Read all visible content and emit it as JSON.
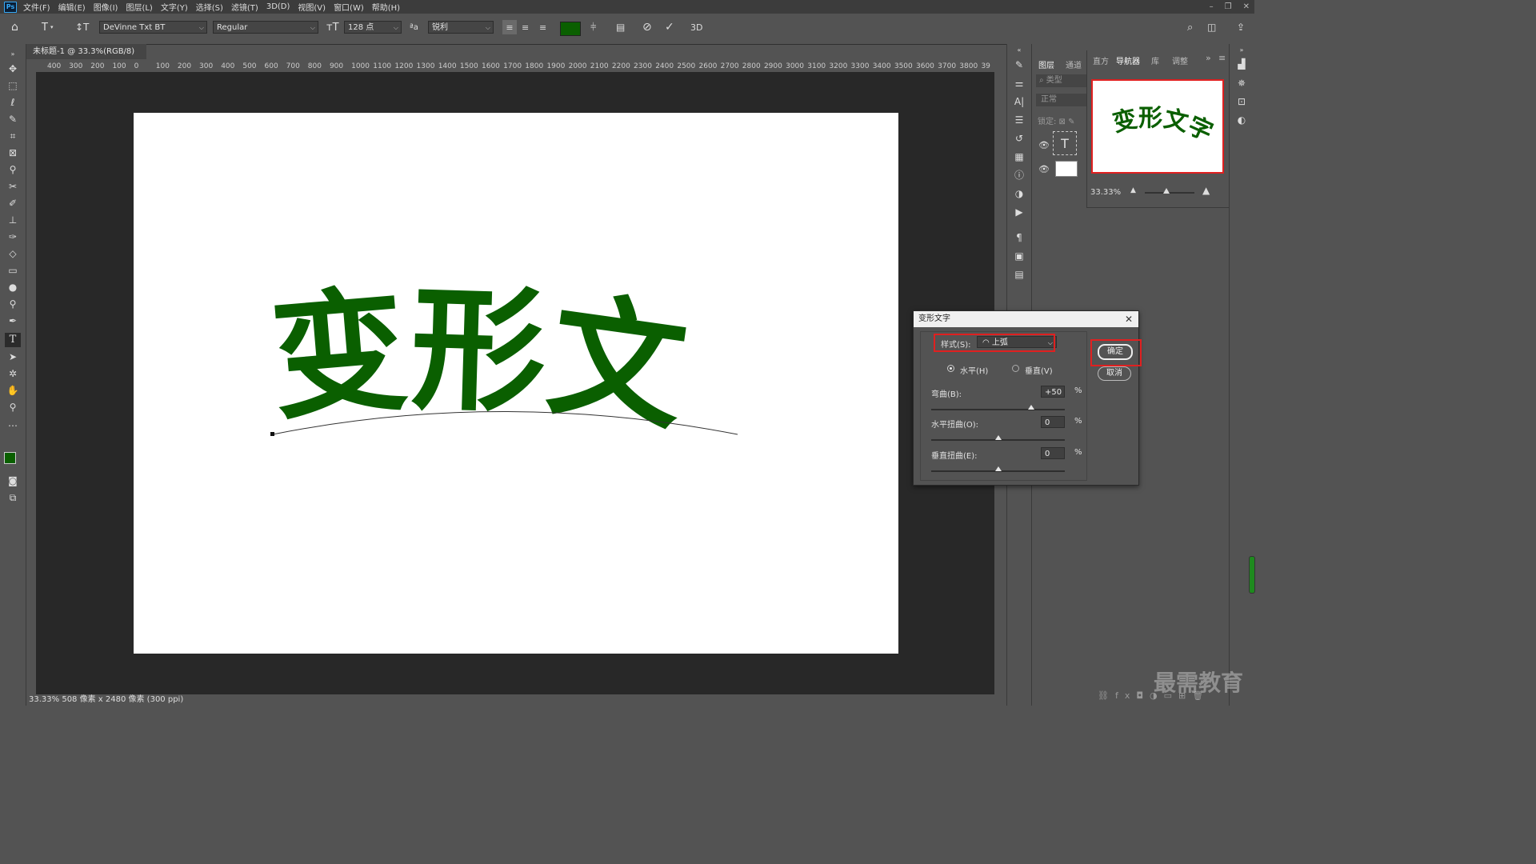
{
  "app": {
    "logo": "Ps"
  },
  "menu": [
    "文件(F)",
    "编辑(E)",
    "图像(I)",
    "图层(L)",
    "文字(Y)",
    "选择(S)",
    "滤镜(T)",
    "3D(D)",
    "视图(V)",
    "窗口(W)",
    "帮助(H)"
  ],
  "window_controls": [
    "–",
    "❐",
    "✕"
  ],
  "options": {
    "font_family": "DeVinne Txt BT",
    "font_style": "Regular",
    "font_size": "128 点",
    "aa_label": "ªa",
    "antialias": "锐利",
    "color": "#0a5f00",
    "threed": "3D"
  },
  "document": {
    "tab_title": "未标题-1 @ 33.3%(RGB/8)",
    "close": "×",
    "status_zoom": "33.33%",
    "status_info": "508 像素 x 2480 像素 (300 ppi)"
  },
  "ruler_labels": [
    "400",
    "300",
    "200",
    "100",
    "0",
    "100",
    "200",
    "300",
    "400",
    "500",
    "600",
    "700",
    "800",
    "900",
    "1000",
    "1100",
    "1200",
    "1300",
    "1400",
    "1500",
    "1600",
    "1700",
    "1800",
    "1900",
    "2000",
    "2100",
    "2200",
    "2300",
    "2400",
    "2500",
    "2600",
    "2700",
    "2800",
    "2900",
    "3000",
    "3100",
    "3200",
    "3300",
    "3400",
    "3500",
    "3600",
    "3700",
    "3800",
    "39"
  ],
  "canvas": {
    "text": "变形文字",
    "text_color": "#0a5f00"
  },
  "panels": {
    "tabs_left": [
      "图层",
      "通道"
    ],
    "tabs_right": [
      "直方",
      "导航器",
      "库",
      "调整"
    ],
    "layer_filter": "类型",
    "blend_mode": "正常",
    "lock_label": "锁定:",
    "navigator_zoom": "33.33%"
  },
  "dialog": {
    "title": "变形文字",
    "close": "✕",
    "style_label": "样式(S):",
    "style_value": "上弧",
    "orient_horizontal": "水平(H)",
    "orient_vertical": "垂直(V)",
    "bend_label": "弯曲(B):",
    "bend_value": "+50",
    "hdist_label": "水平扭曲(O):",
    "hdist_value": "0",
    "vdist_label": "垂直扭曲(E):",
    "vdist_value": "0",
    "percent": "%",
    "ok": "确定",
    "cancel": "取消",
    "bend": 50,
    "hdist": 0,
    "vdist": 0
  },
  "watermark": "最需教育"
}
